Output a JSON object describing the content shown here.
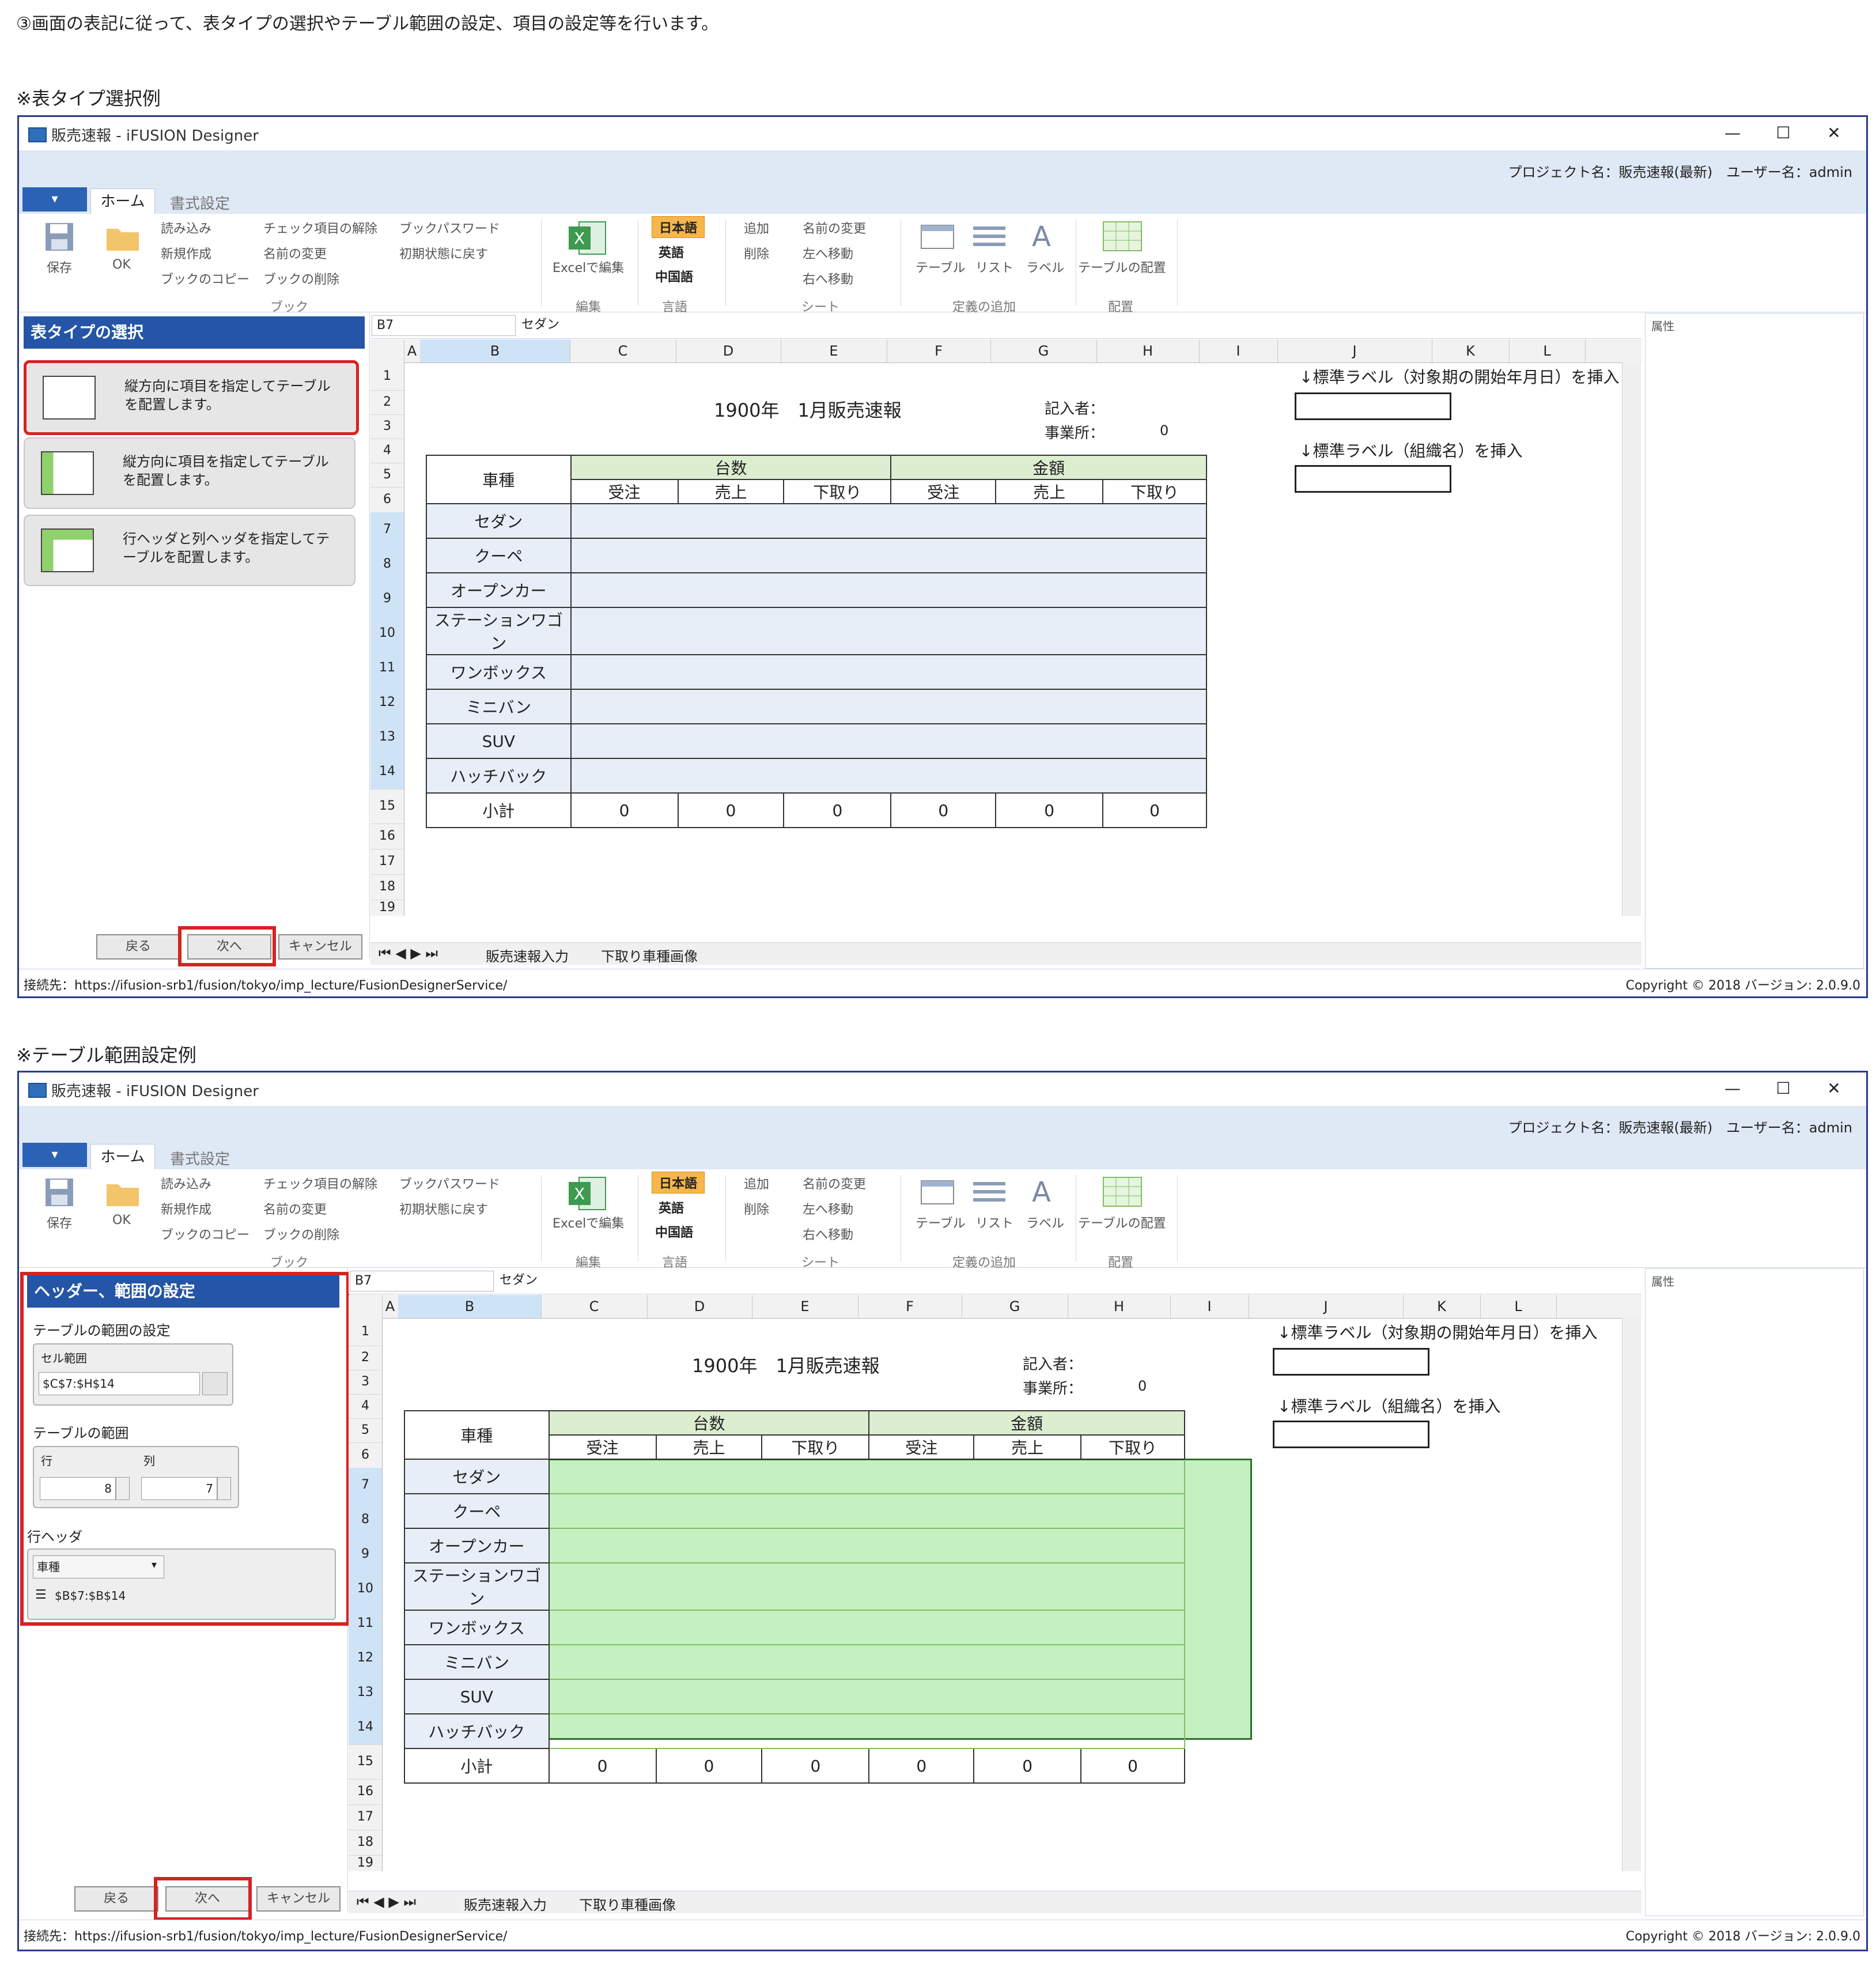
{
  "intro": "③画面の表記に従って、表タイプの選択やテーブル範囲の設定、項目の設定等を行います。",
  "window": {
    "title": "販売速報 - iFUSION Designer",
    "min": "—",
    "max": "☐",
    "close": "✕",
    "project_info": "プロジェクト名：販売速報(最新)　ユーザー名：admin",
    "file_tab": "▾",
    "home_tab": "ホーム",
    "format_tab": "書式設定"
  },
  "ribbon": {
    "save": "保存",
    "ok": "OK",
    "read": "読み込み",
    "new": "新規作成",
    "copy_book": "ブックのコピー",
    "check_clear": "チェック項目の解除",
    "rename": "名前の変更",
    "delete_book": "ブックの削除",
    "book_password": "ブックパスワード",
    "refresh": "初期状態に戻す",
    "group_book": "ブック",
    "excel_edit": "Excelで編集",
    "group_edit": "編集",
    "lang_ja": "日本語",
    "lang_en": "英語",
    "lang_zh": "中国語",
    "group_lang": "言語",
    "sheet_add": "追加",
    "sheet_delete": "削除",
    "sheet_rename": "名前の変更",
    "sheet_left": "左へ移動",
    "sheet_right": "右へ移動",
    "group_sheet": "シート",
    "table": "テーブル",
    "list": "リスト",
    "label": "ラベル",
    "group_define": "定義の追加",
    "table_layout": "テーブルの配置",
    "group_layout": "配置"
  },
  "caption1": "※表タイプ選択例",
  "caption2": "※テーブル範囲設定例",
  "panel1": {
    "title": "表タイプの選択",
    "cards": [
      "縦方向に項目を指定してテーブルを配置します。",
      "縦方向に項目を指定してテーブルを配置します。",
      "行ヘッダと列ヘッダを指定してテーブルを配置します。"
    ],
    "back": "戻る",
    "next": "次へ",
    "cancel": "キャンセル"
  },
  "panel2": {
    "title": "ヘッダー、範囲の設定",
    "sec_range": "テーブルの範囲の設定",
    "cell_range_label": "セル範囲",
    "cell_range_value": "$C$7:$H$14",
    "sec_size": "テーブルの範囲",
    "row_label": "行",
    "col_label": "列",
    "row_value": "8",
    "col_value": "7",
    "sec_header": "行ヘッダ",
    "header_select": "車種",
    "header_range": "$B$7:$B$14",
    "back": "戻る",
    "next": "次へ",
    "cancel": "キャンセル"
  },
  "formula": {
    "name": "B7",
    "value": "セダン"
  },
  "columns": [
    "A",
    "B",
    "C",
    "D",
    "E",
    "F",
    "G",
    "H",
    "I",
    "J",
    "K",
    "L"
  ],
  "rows": [
    "1",
    "2",
    "3",
    "4",
    "5",
    "6",
    "7",
    "8",
    "9",
    "10",
    "11",
    "12",
    "13",
    "14",
    "15",
    "16",
    "17",
    "18",
    "19"
  ],
  "report": {
    "title": "1900年　1月販売速報",
    "recorder_label": "記入者：",
    "office_label": "事業所：",
    "office_value": "0",
    "note1": "↓標準ラベル（対象期の開始年月日）を挿入",
    "note2": "↓標準ラベル（組織名）を挿入",
    "header_model": "車種",
    "group_units": "台数",
    "group_amount": "金額",
    "sub_headers": [
      "受注",
      "売上",
      "下取り",
      "受注",
      "売上",
      "下取り"
    ],
    "models": [
      "セダン",
      "クーペ",
      "オープンカー",
      "ステーションワゴン",
      "ワンボックス",
      "ミニバン",
      "SUV",
      "ハッチバック"
    ],
    "subtotal_label": "小計",
    "subtotals": [
      "0",
      "0",
      "0",
      "0",
      "0",
      "0"
    ]
  },
  "sheets": {
    "tab1": "販売速報入力",
    "tab2": "下取り車種画像"
  },
  "props": "属性",
  "status": {
    "connection": "接続先：https://ifusion-srb1/fusion/tokyo/imp_lecture/FusionDesignerService/",
    "copyright": "Copyright ©  2018  バージョン: 2.0.9.0"
  }
}
